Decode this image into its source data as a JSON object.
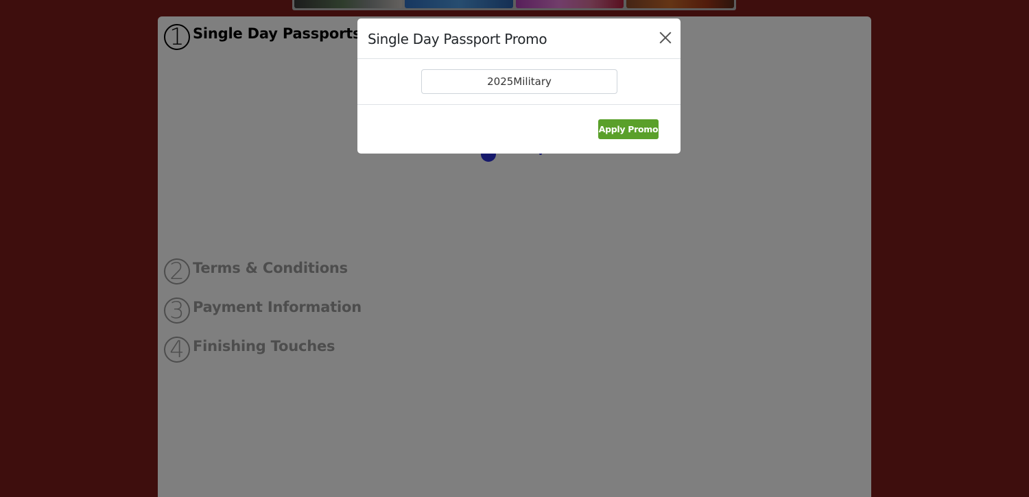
{
  "banner": {
    "thumbnails": [
      "thumbnail-1",
      "thumbnail-2",
      "thumbnail-3",
      "thumbnail-4"
    ]
  },
  "steps": [
    {
      "number": "1",
      "title": "Single Day Passports",
      "active": true
    },
    {
      "number": "2",
      "title": "Terms & Conditions",
      "active": false
    },
    {
      "number": "3",
      "title": "Payment Information",
      "active": false
    },
    {
      "number": "4",
      "title": "Finishing Touches",
      "active": false
    }
  ],
  "modal": {
    "title": "Single Day Passport Promo",
    "promo_value": "2025Military",
    "apply_label": "Apply Promo",
    "close_icon": "close-icon"
  },
  "colors": {
    "page_background": "#7d1c1a",
    "apply_button": "#5aa02a",
    "loading_indicator": "#2c33d6"
  }
}
